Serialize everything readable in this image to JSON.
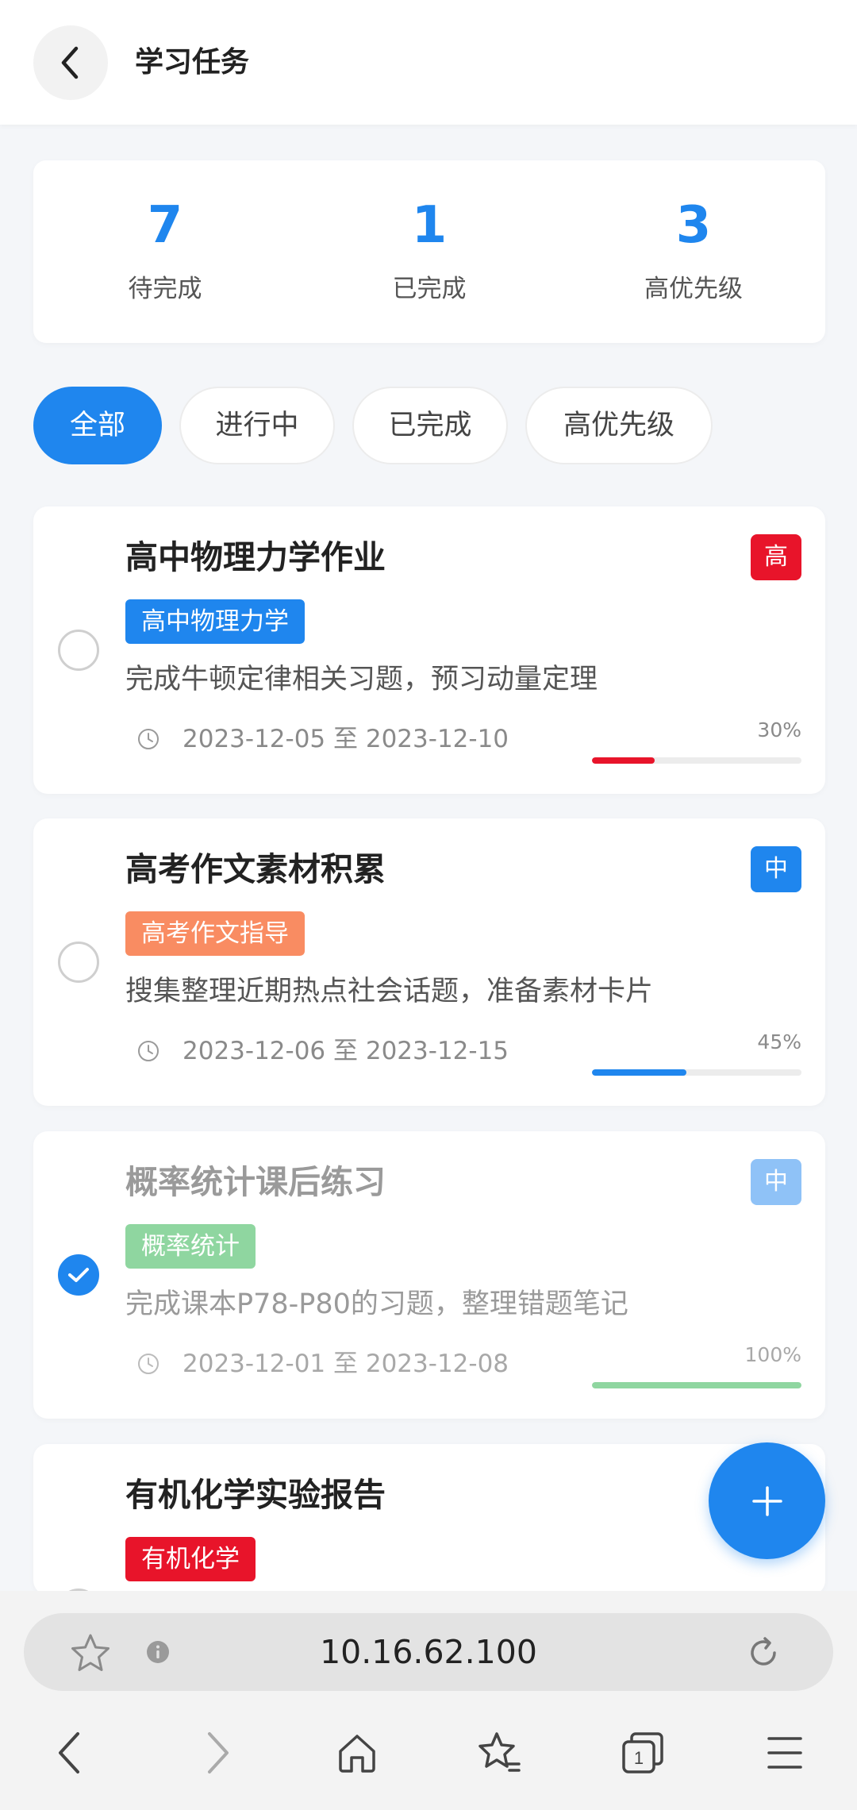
{
  "header": {
    "title": "学习任务"
  },
  "stats": [
    {
      "value": "7",
      "label": "待完成"
    },
    {
      "value": "1",
      "label": "已完成"
    },
    {
      "value": "3",
      "label": "高优先级"
    }
  ],
  "filters": {
    "all": "全部",
    "in_progress": "进行中",
    "completed": "已完成",
    "high_priority": "高优先级",
    "active": "全部"
  },
  "tasks": [
    {
      "title": "高中物理力学作业",
      "priority": "高",
      "priority_color": "#e8142a",
      "tag": "高中物理力学",
      "tag_color": "#1f86ee",
      "desc": "完成牛顿定律相关习题，预习动量定理",
      "dates": "2023-12-05 至 2023-12-10",
      "progress_label": "30%",
      "progress": 0.3,
      "progress_color": "#e8142a",
      "completed": false
    },
    {
      "title": "高考作文素材积累",
      "priority": "中",
      "priority_color": "#1f86ee",
      "tag": "高考作文指导",
      "tag_color": "#f98c62",
      "desc": "搜集整理近期热点社会话题，准备素材卡片",
      "dates": "2023-12-06 至 2023-12-15",
      "progress_label": "45%",
      "progress": 0.45,
      "progress_color": "#1f86ee",
      "completed": false
    },
    {
      "title": "概率统计课后练习",
      "priority": "中",
      "priority_color": "#8fc2f7",
      "tag": "概率统计",
      "tag_color": "#8fd6a0",
      "desc": "完成课本P78-P80的习题，整理错题笔记",
      "dates": "2023-12-01 至 2023-12-08",
      "progress_label": "100%",
      "progress": 1.0,
      "progress_color": "#8fd6a0",
      "completed": true
    },
    {
      "title": "有机化学实验报告",
      "tag": "有机化学",
      "tag_color": "#e8142a",
      "completed": false
    }
  ],
  "browser": {
    "url": "10.16.62.100"
  },
  "colors": {
    "accent": "#1f86ee",
    "danger": "#e8142a"
  }
}
